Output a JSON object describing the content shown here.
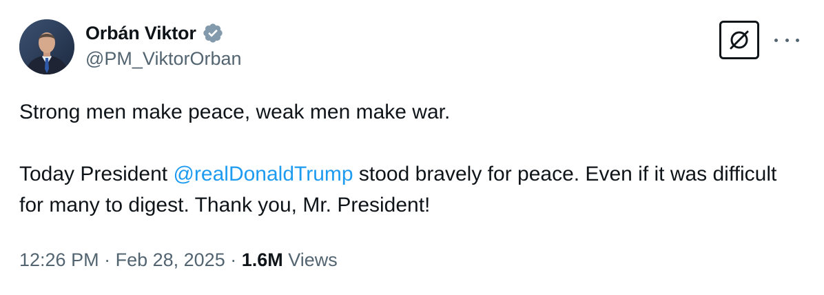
{
  "author": {
    "display_name": "Orbán Viktor",
    "handle": "@PM_ViktorOrban",
    "verified": true,
    "avatar_icon": "profile-photo"
  },
  "actions": {
    "grok_icon": "grok-icon",
    "more_icon": "more-icon"
  },
  "tweet": {
    "line1": "Strong men make peace, weak men make war.",
    "line2_before": "Today President ",
    "mention": "@realDonaldTrump",
    "line2_after": " stood bravely for peace. Even if it was difficult for many to digest. Thank you, Mr. President!"
  },
  "meta": {
    "time": "12:26 PM",
    "separator": " · ",
    "date": "Feb 28, 2025",
    "views_count": "1.6M",
    "views_label": "Views"
  },
  "colors": {
    "text": "#0f1419",
    "secondary": "#536471",
    "link": "#1d9bf0",
    "verified_badge": "#829aab"
  }
}
